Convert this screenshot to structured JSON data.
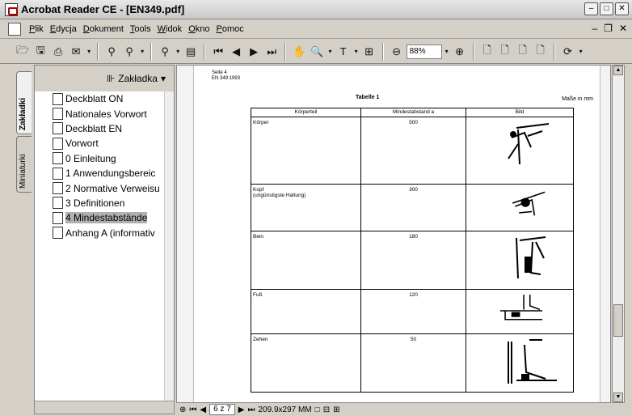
{
  "window": {
    "title": "Acrobat Reader CE - [EN349.pdf]"
  },
  "menu": [
    "Plik",
    "Edycja",
    "Dokument",
    "Tools",
    "Widok",
    "Okno",
    "Pomoc"
  ],
  "toolbar": {
    "zoom": "88%"
  },
  "side_tabs": {
    "bookmarks": "Zakładki",
    "thumbnails": "Miniaturki"
  },
  "panel": {
    "options_label": "Zakładka"
  },
  "bookmarks": [
    "Deckblatt ON",
    "Nationales Vorwort",
    "Deckblatt EN",
    "Vorwort",
    "0 Einleitung",
    "1 Anwendungsbereic",
    "2 Normative Verweisu",
    "3 Definitionen",
    "4 Mindestabstände",
    "Anhang A (informativ"
  ],
  "selected_bookmark": "4 Mindestabstände",
  "document": {
    "page_header_1": "Seite 4",
    "page_header_2": "EN 349:1993",
    "table_title": "Tabelle 1",
    "units": "Maße in mm",
    "col_headers": [
      "Körperteil",
      "Mindestabstand a",
      "Bild"
    ],
    "rows": [
      {
        "part": "Körper",
        "value": "500"
      },
      {
        "part": "Kopf\n(ungünstigste Haltung)",
        "value": "300"
      },
      {
        "part": "Bein",
        "value": "180"
      },
      {
        "part": "Fuß",
        "value": "120"
      },
      {
        "part": "Zehen",
        "value": "50"
      }
    ]
  },
  "status": {
    "page": "6 z 7",
    "size": "209.9x297 MM"
  }
}
